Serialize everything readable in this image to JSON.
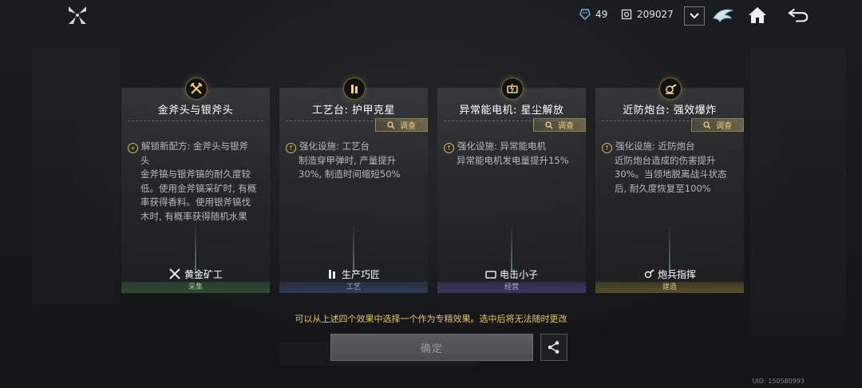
{
  "top": {
    "res1_value": "49",
    "res2_value": "209027",
    "icons": [
      "logo-icon",
      "crystal-icon",
      "gear-resource-icon",
      "dropdown-chevron-icon",
      "dragon-emblem-icon",
      "home-icon",
      "back-arrow-icon"
    ]
  },
  "cards": [
    {
      "title": "金斧头与银斧头",
      "investigate": "调查",
      "desc_head": "解锁新配方: 金斧头与银斧",
      "desc_lines": [
        "头",
        "金斧镐与银斧镐的耐久度较",
        "低。使用金斧镐采矿时, 有概",
        "率获得香料。使用银斧镐伐",
        "木时, 有概率获得随机水果"
      ],
      "footer": "黄金矿工",
      "tag": "采集",
      "icon": "crossed-pickaxes-icon"
    },
    {
      "title": "工艺台: 护甲克星",
      "investigate": "调查",
      "desc_head": "强化设施: 工艺台",
      "desc_lines": [
        "制造穿甲弹时, 产量提升",
        "30%, 制造时间缩短50%"
      ],
      "footer": "生产巧匠",
      "tag": "工艺",
      "icon": "bullets-icon"
    },
    {
      "title": "异常能电机: 星尘解放",
      "investigate": "调查",
      "desc_head": "强化设施: 异常能电机",
      "desc_lines": [
        "异常能电机发电量提升15%"
      ],
      "footer": "电击小子",
      "tag": "经营",
      "icon": "generator-icon"
    },
    {
      "title": "近防炮台: 强效爆炸",
      "investigate": "调查",
      "desc_head": "强化设施: 近防炮台",
      "desc_lines": [
        "近防炮台造成的伤害提升",
        "30%。当领地脱离战斗状态",
        "后, 耐久度恢复至100%"
      ],
      "footer": "炮兵指挥",
      "tag": "建造",
      "icon": "turret-icon"
    }
  ],
  "hint": "可以从上述四个效果中选择一个作为专精效果。选中后将无法随时更改",
  "confirm_label": "确定",
  "uid": "UID: 150580993",
  "colors": {
    "accent_gold": "#e8c06a",
    "bg": "#15181b"
  }
}
